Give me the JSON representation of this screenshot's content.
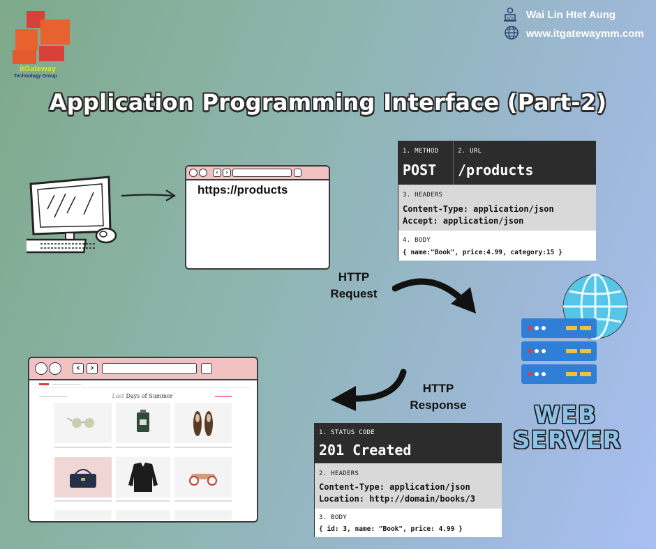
{
  "brand": {
    "logo_name": "itGateway",
    "logo_sub": "Technology Group",
    "colors": {
      "logo_orange": "#e8622f",
      "logo_red": "#d8403a",
      "logo_yellow": "#d8e62a",
      "logo_navy": "#1f2d7a"
    }
  },
  "author": {
    "name": "Wai Lin Htet Aung",
    "website": "www.itgatewaymm.com",
    "icons": [
      "developer-icon",
      "globe-icon"
    ]
  },
  "title": "Application Programming Interface (Part-2)",
  "client_browser": {
    "url": "https://products",
    "icons": [
      "computer-icon",
      "arrow-right-icon"
    ]
  },
  "request": {
    "method_label": "1. METHOD",
    "method": "POST",
    "url_label": "2. URL",
    "url": "/products",
    "headers_label": "3. HEADERS",
    "headers": [
      "Content-Type: application/json",
      "Accept: application/json"
    ],
    "body_label": "4. BODY",
    "body": "{ name:\"Book\", price:4.99, category:15 }"
  },
  "http_request_label": [
    "HTTP",
    "Request"
  ],
  "http_response_label": [
    "HTTP",
    "Response"
  ],
  "server": {
    "label": [
      "WEB",
      "SERVER"
    ],
    "icons": [
      "globe-icon",
      "server-icon"
    ],
    "colors": {
      "server_blue": "#2f7fd6",
      "globe_blue": "#55c6e8",
      "slot_yellow": "#f0c23a"
    }
  },
  "response": {
    "status_label": "1. STATUS CODE",
    "status": "201 Created",
    "headers_label": "2. HEADERS",
    "headers": [
      "Content-Type: application/json",
      "Location: http://domain/books/3"
    ],
    "body_label": "3. BODY",
    "body": "{ id: 3, name: \"Book\", price: 4.99 }"
  },
  "shop_page": {
    "heading_part1": "Last",
    "heading_part2": "Days of Summer"
  }
}
